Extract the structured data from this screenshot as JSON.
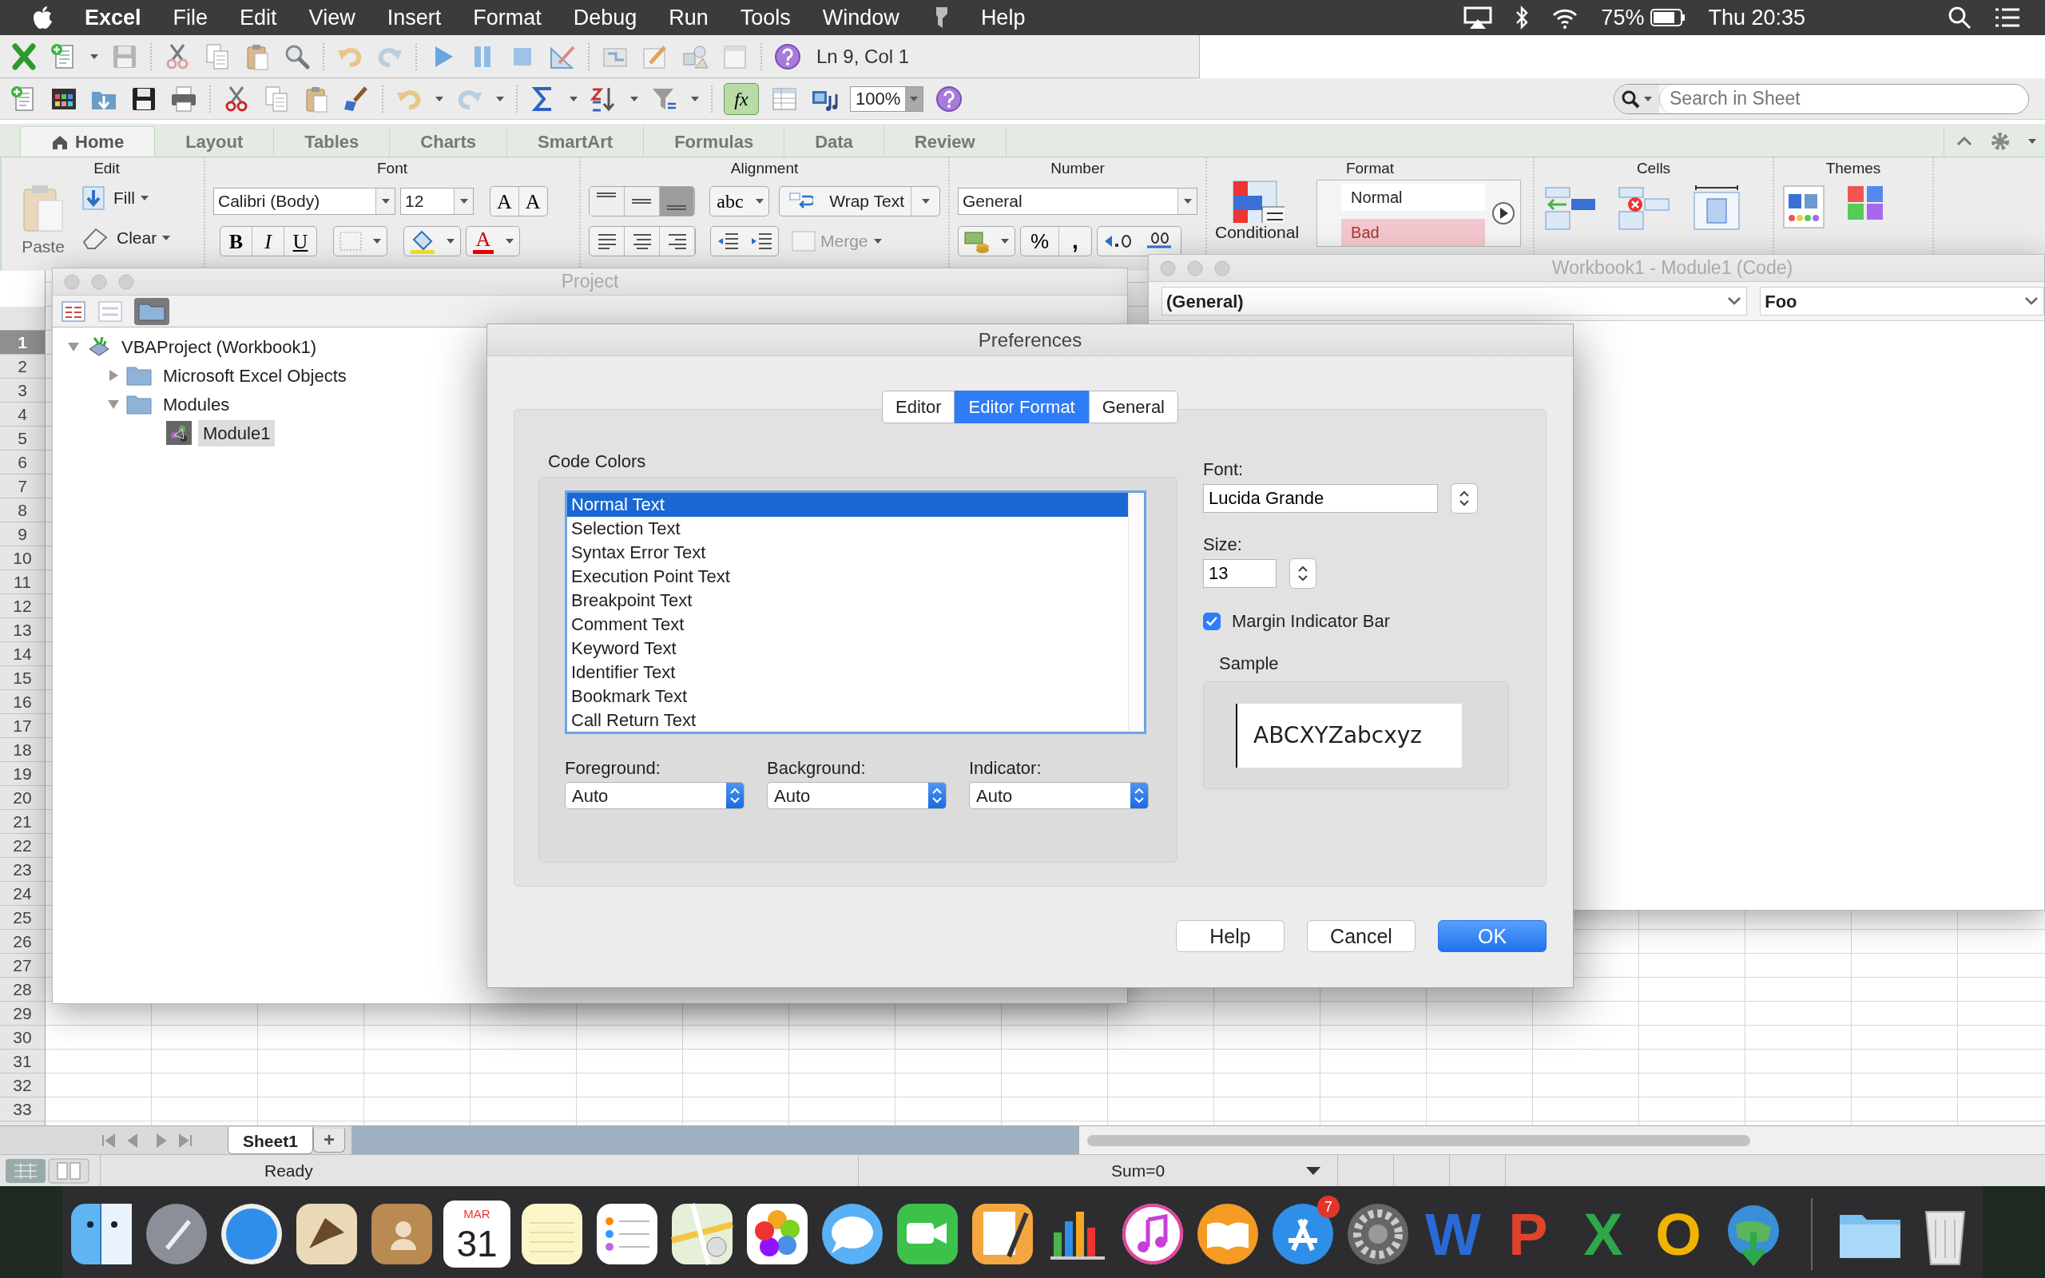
{
  "menu_bar": {
    "app": "Excel",
    "items": [
      {
        "kind": "text",
        "label": "File"
      },
      {
        "kind": "text",
        "label": "Edit"
      },
      {
        "kind": "text",
        "label": "View"
      },
      {
        "kind": "text",
        "label": "Insert"
      },
      {
        "kind": "text",
        "label": "Format"
      },
      {
        "kind": "text",
        "label": "Debug"
      },
      {
        "kind": "text",
        "label": "Run"
      },
      {
        "kind": "text",
        "label": "Tools"
      },
      {
        "kind": "text",
        "label": "Window"
      },
      {
        "kind": "icon"
      },
      {
        "kind": "text",
        "label": "Help"
      }
    ],
    "battery": "75%",
    "clock": "Thu 20:35"
  },
  "vbe_toolbar": {
    "position": "Ln 9, Col 1"
  },
  "standard_toolbar": {
    "formula_builder": {
      "label": "fx",
      "on": true
    },
    "zoom": "100%",
    "search": {
      "placeholder": "Search in Sheet"
    }
  },
  "ribbon": {
    "tabs": [
      {
        "label": "Home",
        "selected": true
      },
      {
        "label": "Layout",
        "selected": false
      },
      {
        "label": "Tables",
        "selected": false
      },
      {
        "label": "Charts",
        "selected": false
      },
      {
        "label": "SmartArt",
        "selected": false
      },
      {
        "label": "Formulas",
        "selected": false
      },
      {
        "label": "Data",
        "selected": false
      },
      {
        "label": "Review",
        "selected": false
      }
    ],
    "edit": {
      "title": "Edit",
      "paste": "Paste",
      "fill": "Fill",
      "clear": "Clear"
    },
    "font": {
      "title": "Font",
      "font_name": "Calibri (Body)",
      "font_size": "12",
      "grow": "A",
      "shrink": "A",
      "bold": "B",
      "italic": "I",
      "underline": "U",
      "font_color_button": "A"
    },
    "alignment": {
      "title": "Alignment",
      "vertical": [
        {
          "selected": false
        },
        {
          "selected": false
        },
        {
          "selected": true
        }
      ],
      "orientation": "abc",
      "wrap_text": "Wrap Text",
      "merge": {
        "label": "Merge",
        "disabled": true
      }
    },
    "number": {
      "title": "Number",
      "format": "General",
      "percent": "%",
      "comma": ","
    },
    "format": {
      "title": "Format",
      "conditional": "Conditional",
      "styles": [
        {
          "label": "Normal",
          "color": "#ffffff"
        },
        {
          "label": "Bad",
          "color": "#f4c7ce"
        }
      ]
    },
    "cells": {
      "title": "Cells"
    },
    "themes": {
      "title": "Themes"
    }
  },
  "project_window": {
    "title": "Project",
    "tree": [
      {
        "kind": "project",
        "label": "VBAProject (Workbook1)",
        "expanded": true,
        "selected": false,
        "children": [
          {
            "kind": "folder",
            "label": "Microsoft Excel Objects",
            "expanded": false,
            "selected": false
          },
          {
            "kind": "folder",
            "label": "Modules",
            "expanded": true,
            "selected": false,
            "children": [
              {
                "kind": "module",
                "label": "Module1",
                "selected": true
              }
            ]
          }
        ]
      }
    ]
  },
  "code_window": {
    "title": "Workbook1 - Module1 (Code)",
    "object": "(General)",
    "procedure": "Foo"
  },
  "preferences": {
    "title": "Preferences",
    "tabs": [
      {
        "label": "Editor",
        "selected": false
      },
      {
        "label": "Editor Format",
        "selected": true
      },
      {
        "label": "General",
        "selected": false
      }
    ],
    "code_colors": {
      "title": "Code Colors",
      "items": [
        {
          "label": "Normal Text",
          "selected": true
        },
        {
          "label": "Selection Text",
          "selected": false
        },
        {
          "label": "Syntax Error Text",
          "selected": false
        },
        {
          "label": "Execution Point Text",
          "selected": false
        },
        {
          "label": "Breakpoint Text",
          "selected": false
        },
        {
          "label": "Comment Text",
          "selected": false
        },
        {
          "label": "Keyword Text",
          "selected": false
        },
        {
          "label": "Identifier Text",
          "selected": false
        },
        {
          "label": "Bookmark Text",
          "selected": false
        },
        {
          "label": "Call Return Text",
          "selected": false
        }
      ],
      "pickers": [
        {
          "label": "Foreground:",
          "value": "Auto"
        },
        {
          "label": "Background:",
          "value": "Auto"
        },
        {
          "label": "Indicator:",
          "value": "Auto"
        }
      ]
    },
    "font": {
      "label": "Font:",
      "value": "Lucida Grande"
    },
    "size": {
      "label": "Size:",
      "value": "13"
    },
    "margin_indicator_bar": {
      "label": "Margin Indicator Bar",
      "checked": true
    },
    "sample": {
      "title": "Sample",
      "text": "ABCXYZabcxyz"
    },
    "buttons": [
      {
        "label": "Help",
        "default": false
      },
      {
        "label": "Cancel",
        "default": false
      },
      {
        "label": "OK",
        "default": true
      }
    ]
  },
  "sheet": {
    "rows": [
      {
        "label": "1",
        "selected": true
      },
      {
        "label": "2",
        "selected": false
      },
      {
        "label": "3",
        "selected": false
      },
      {
        "label": "4",
        "selected": false
      },
      {
        "label": "5",
        "selected": false
      },
      {
        "label": "6",
        "selected": false
      },
      {
        "label": "7",
        "selected": false
      },
      {
        "label": "8",
        "selected": false
      },
      {
        "label": "9",
        "selected": false
      },
      {
        "label": "10",
        "selected": false
      },
      {
        "label": "11",
        "selected": false
      },
      {
        "label": "12",
        "selected": false
      },
      {
        "label": "13",
        "selected": false
      },
      {
        "label": "14",
        "selected": false
      },
      {
        "label": "15",
        "selected": false
      },
      {
        "label": "16",
        "selected": false
      },
      {
        "label": "17",
        "selected": false
      },
      {
        "label": "18",
        "selected": false
      },
      {
        "label": "19",
        "selected": false
      },
      {
        "label": "20",
        "selected": false
      },
      {
        "label": "21",
        "selected": false
      },
      {
        "label": "22",
        "selected": false
      },
      {
        "label": "23",
        "selected": false
      },
      {
        "label": "24",
        "selected": false
      },
      {
        "label": "25",
        "selected": false
      },
      {
        "label": "26",
        "selected": false
      },
      {
        "label": "27",
        "selected": false
      },
      {
        "label": "28",
        "selected": false
      },
      {
        "label": "29",
        "selected": false
      },
      {
        "label": "30",
        "selected": false
      },
      {
        "label": "31",
        "selected": false
      },
      {
        "label": "32",
        "selected": false
      },
      {
        "label": "33",
        "selected": false
      }
    ],
    "tabs": [
      {
        "label": "Sheet1",
        "selected": true
      }
    ],
    "add_tab": "+"
  },
  "status_bar": {
    "status": "Ready",
    "sum": "Sum=0"
  },
  "dock": {
    "calendar": {
      "month": "MAR",
      "day": "31"
    },
    "app_store_badge": "7",
    "letters": [
      "W",
      "P",
      "X",
      "O"
    ]
  }
}
